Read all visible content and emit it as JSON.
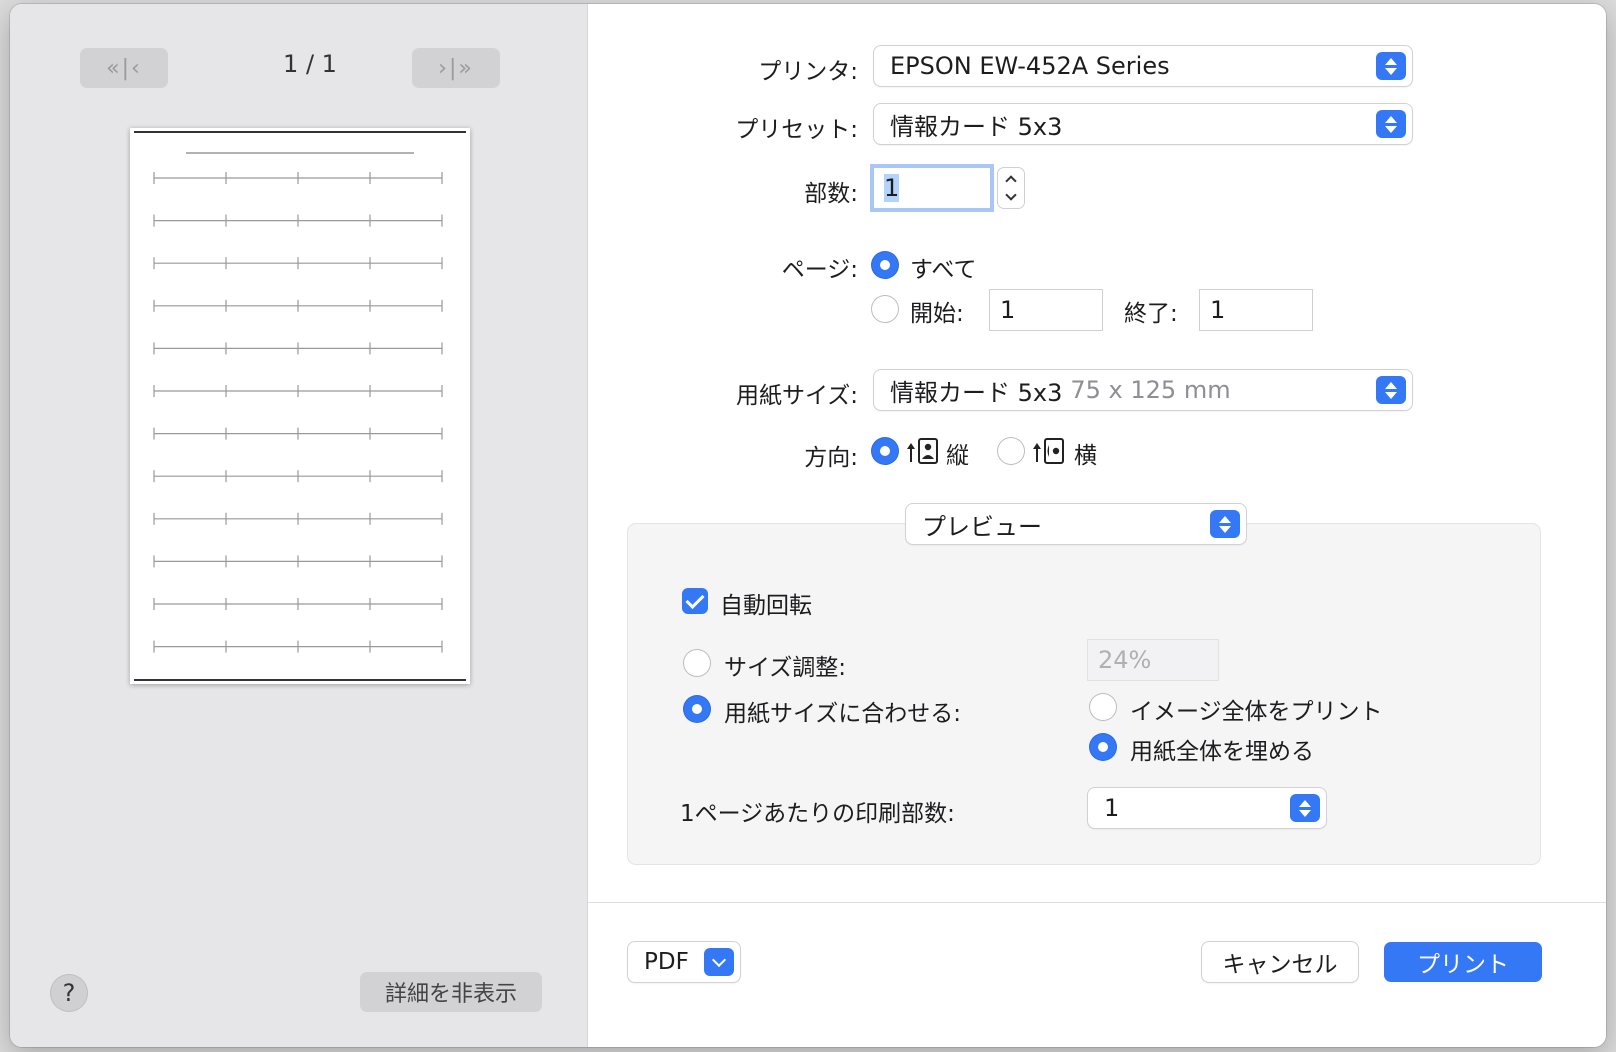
{
  "preview": {
    "page_indicator": "1 / 1",
    "first_prev_glyph": "«|‹",
    "next_last_glyph": "›|»",
    "help_label": "?",
    "hide_details_label": "詳細を非表示"
  },
  "printer": {
    "label": "プリンタ:",
    "value": "EPSON EW-452A Series"
  },
  "preset": {
    "label": "プリセット:",
    "value": "情報カード 5x3"
  },
  "copies": {
    "label": "部数:",
    "value": "1"
  },
  "pages": {
    "label": "ページ:",
    "all_label": "すべて",
    "from_label": "開始:",
    "from_value": "1",
    "to_label": "終了:",
    "to_value": "1",
    "selected": "all"
  },
  "paper_size": {
    "label": "用紙サイズ:",
    "value": "情報カード 5x3",
    "dimension": "75 x 125 mm"
  },
  "orientation": {
    "label": "方向:",
    "portrait_label": "縦",
    "landscape_label": "横",
    "selected": "portrait"
  },
  "section_popup": {
    "value": "プレビュー"
  },
  "section": {
    "auto_rotate_label": "自動回転",
    "auto_rotate_checked": true,
    "scale_label": "サイズ調整:",
    "scale_value": "24%",
    "fit_label": "用紙サイズに合わせる:",
    "print_entire_label": "イメージ全体をプリント",
    "fill_paper_label": "用紙全体を埋める",
    "pages_per_sheet_label": "1ページあたりの印刷部数:",
    "pages_per_sheet_value": "1"
  },
  "footer": {
    "pdf_label": "PDF",
    "cancel_label": "キャンセル",
    "print_label": "プリント"
  },
  "colors": {
    "accent": "#3478f6"
  }
}
